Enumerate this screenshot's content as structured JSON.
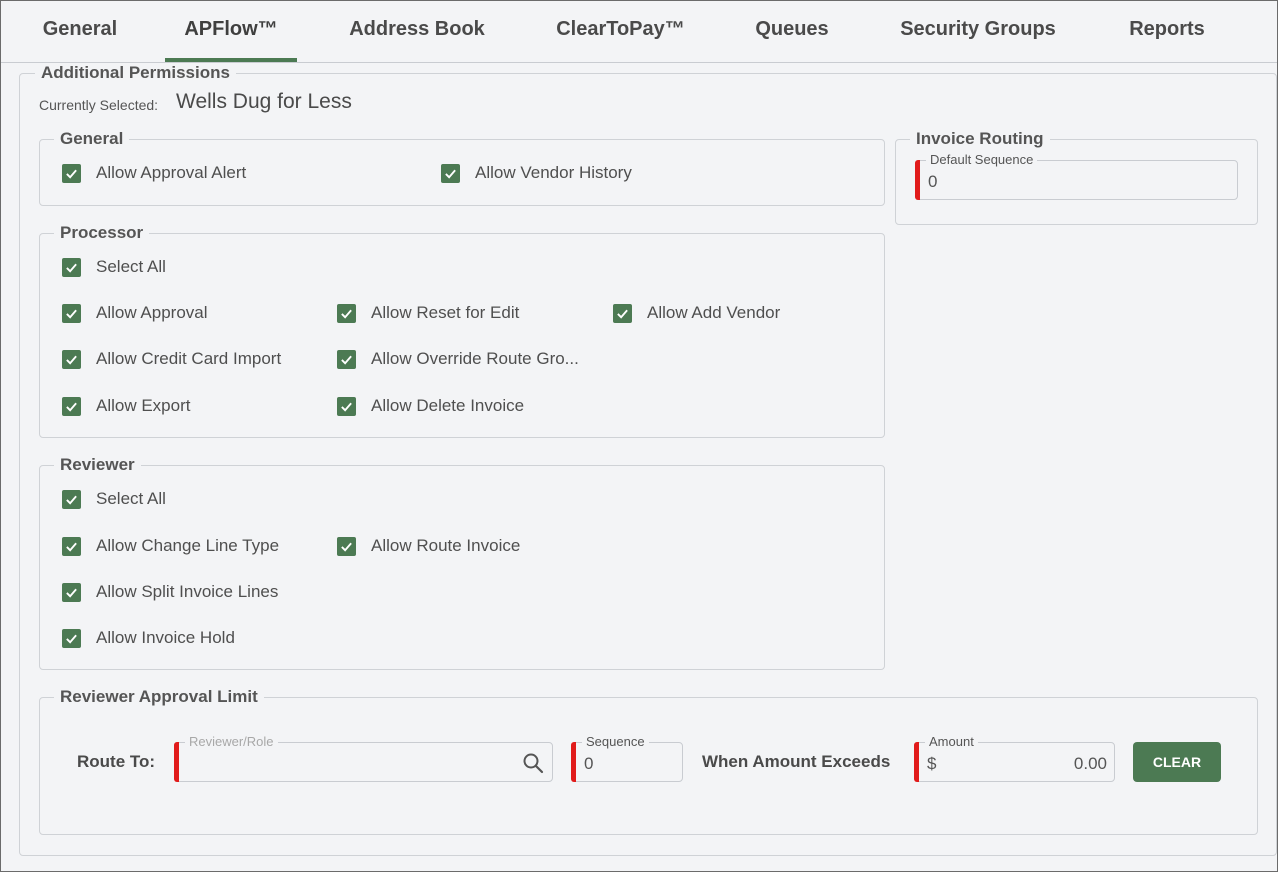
{
  "tabs": [
    {
      "label": "General"
    },
    {
      "label": "APFlow™"
    },
    {
      "label": "Address Book"
    },
    {
      "label": "ClearToPay™"
    },
    {
      "label": "Queues"
    },
    {
      "label": "Security Groups"
    },
    {
      "label": "Reports"
    }
  ],
  "active_tab": "APFlow™",
  "section": {
    "title": "Additional Permissions",
    "currently_selected_label": "Currently Selected:",
    "currently_selected_value": "Wells Dug for Less"
  },
  "general": {
    "title": "General",
    "items": [
      {
        "label": "Allow Approval Alert",
        "checked": true
      },
      {
        "label": "Allow Vendor History",
        "checked": true
      }
    ]
  },
  "invoice_routing": {
    "title": "Invoice Routing",
    "default_sequence_label": "Default Sequence",
    "default_sequence_value": "0"
  },
  "processor": {
    "title": "Processor",
    "select_all": "Select All",
    "items": [
      {
        "label": "Allow Approval",
        "checked": true
      },
      {
        "label": "Allow Reset for Edit",
        "checked": true
      },
      {
        "label": "Allow Add Vendor",
        "checked": true
      },
      {
        "label": "Allow Credit Card Import",
        "checked": true
      },
      {
        "label": "Allow Override Route Gro...",
        "checked": true
      },
      {
        "label": "Allow Export",
        "checked": true
      },
      {
        "label": "Allow Delete Invoice",
        "checked": true
      }
    ]
  },
  "reviewer": {
    "title": "Reviewer",
    "select_all": "Select All",
    "items": [
      {
        "label": "Allow Change Line Type",
        "checked": true
      },
      {
        "label": "Allow Route Invoice",
        "checked": true
      },
      {
        "label": "Allow Split Invoice Lines",
        "checked": true
      },
      {
        "label": "Allow Invoice Hold",
        "checked": true
      }
    ]
  },
  "approval_limit": {
    "title": "Reviewer Approval Limit",
    "route_to_label": "Route To:",
    "reviewer_placeholder": "Reviewer/Role",
    "sequence_label": "Sequence",
    "sequence_value": "0",
    "when_exceeds_label": "When Amount Exceeds",
    "amount_label": "Amount",
    "currency_symbol": "$",
    "amount_value": "0.00",
    "clear_label": "CLEAR"
  },
  "colors": {
    "accent": "#4c7a53",
    "required": "#e11b1b"
  }
}
